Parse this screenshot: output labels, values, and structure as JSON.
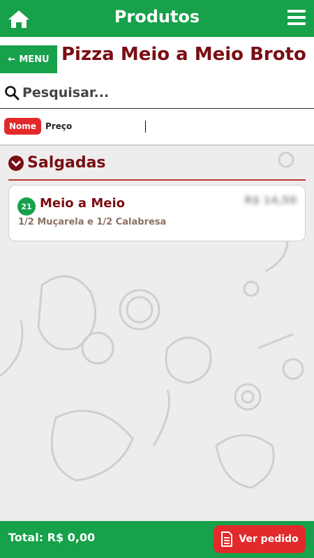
{
  "header": {
    "title": "Produtos",
    "home_icon": "home-icon",
    "menu_icon": "hamburger-menu-icon"
  },
  "subheader": {
    "menu_button_label": "MENU",
    "page_title": "Pizza Meio a Meio Broto"
  },
  "search": {
    "placeholder": "Pesquisar...",
    "value": ""
  },
  "sort": {
    "active": "Nome",
    "other": "Preço"
  },
  "category": {
    "title": "Salgadas"
  },
  "items": [
    {
      "badge": "21",
      "name": "Meio a Meio",
      "price": "R$ 14,50",
      "description": "1/2 Muçarela e 1/2 Calabresa"
    }
  ],
  "footer": {
    "total": "Total: R$ 0,00",
    "order_button_label": "Ver pedido"
  },
  "colors": {
    "green": "#16a14a",
    "maroon": "#7a0e13",
    "red": "#e22a2a"
  }
}
